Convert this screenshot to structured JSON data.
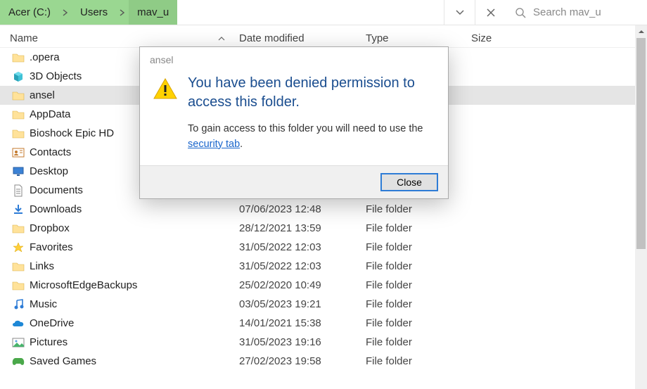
{
  "breadcrumb": {
    "parts": [
      "Acer (C:)",
      "Users",
      "mav_u"
    ]
  },
  "search": {
    "placeholder": "Search mav_u"
  },
  "columns": {
    "name": "Name",
    "date": "Date modified",
    "type": "Type",
    "size": "Size"
  },
  "type_label": "File folder",
  "items": [
    {
      "name": ".opera",
      "date": "",
      "type": "",
      "icon": "folder"
    },
    {
      "name": "3D Objects",
      "date": "",
      "type": "",
      "icon": "3d"
    },
    {
      "name": "ansel",
      "date": "",
      "type": "",
      "icon": "folder",
      "selected": true
    },
    {
      "name": "AppData",
      "date": "",
      "type": "",
      "icon": "folder"
    },
    {
      "name": "Bioshock Epic HD",
      "date": "",
      "type": "",
      "icon": "folder"
    },
    {
      "name": "Contacts",
      "date": "",
      "type": "",
      "icon": "contacts"
    },
    {
      "name": "Desktop",
      "date": "",
      "type": "",
      "icon": "desktop"
    },
    {
      "name": "Documents",
      "date": "",
      "type": "",
      "icon": "documents"
    },
    {
      "name": "Downloads",
      "date": "07/06/2023 12:48",
      "type": "File folder",
      "icon": "downloads"
    },
    {
      "name": "Dropbox",
      "date": "28/12/2021 13:59",
      "type": "File folder",
      "icon": "dropbox"
    },
    {
      "name": "Favorites",
      "date": "31/05/2022 12:03",
      "type": "File folder",
      "icon": "favorites"
    },
    {
      "name": "Links",
      "date": "31/05/2022 12:03",
      "type": "File folder",
      "icon": "links"
    },
    {
      "name": "MicrosoftEdgeBackups",
      "date": "25/02/2020 10:49",
      "type": "File folder",
      "icon": "folder"
    },
    {
      "name": "Music",
      "date": "03/05/2023 19:21",
      "type": "File folder",
      "icon": "music"
    },
    {
      "name": "OneDrive",
      "date": "14/01/2021 15:38",
      "type": "File folder",
      "icon": "onedrive"
    },
    {
      "name": "Pictures",
      "date": "31/05/2023 19:16",
      "type": "File folder",
      "icon": "pictures"
    },
    {
      "name": "Saved Games",
      "date": "27/02/2023 19:58",
      "type": "File folder",
      "icon": "savedgames"
    }
  ],
  "dialog": {
    "title": "ansel",
    "heading": "You have been denied permission to access this folder.",
    "msg1": "To gain access to this folder you will need to use the ",
    "link": "security tab",
    "msg2": ".",
    "button": "Close"
  }
}
